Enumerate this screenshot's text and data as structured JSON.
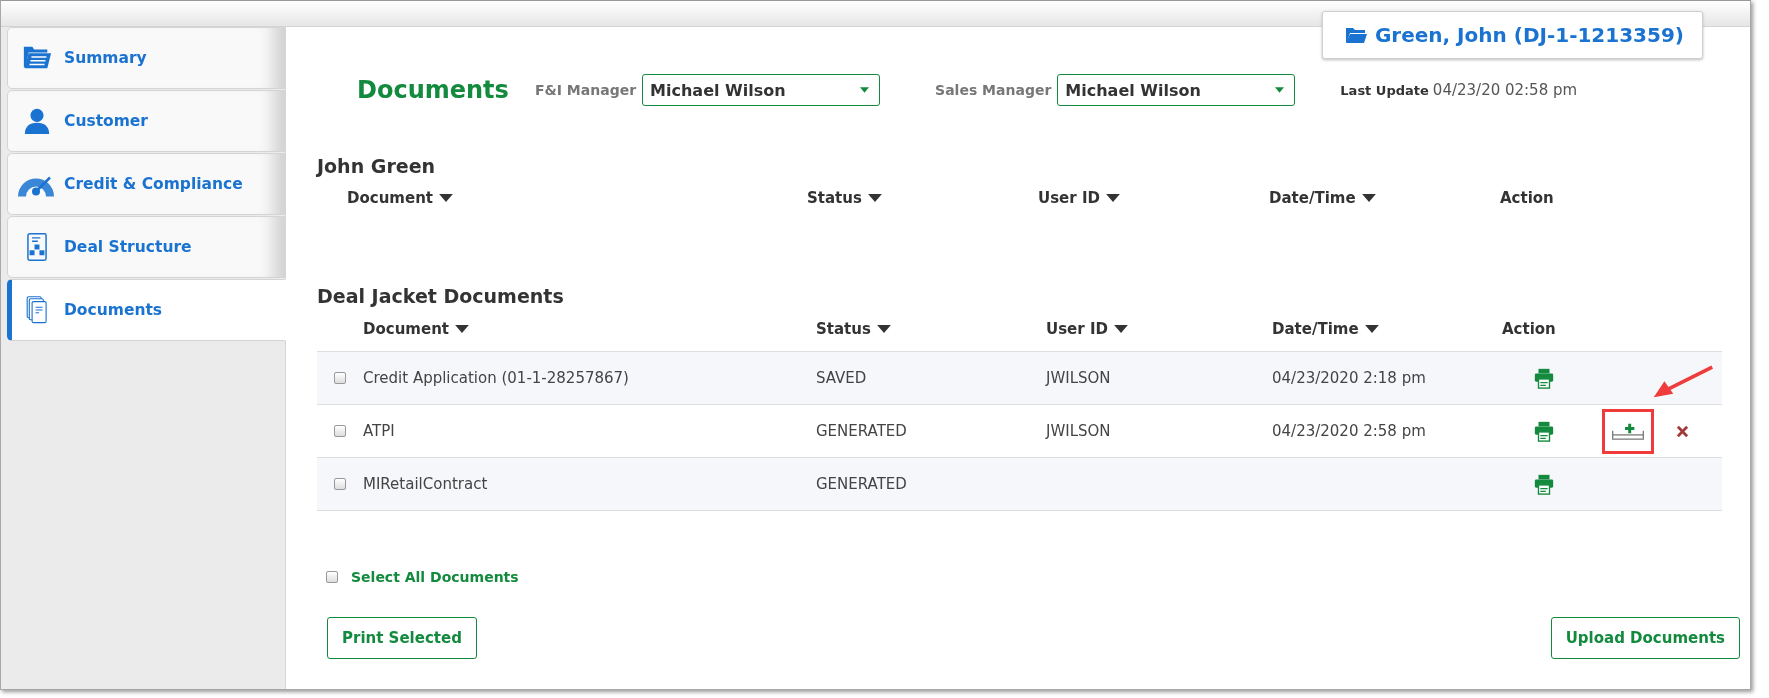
{
  "sidebar": {
    "items": [
      {
        "label": "Summary",
        "selected": false
      },
      {
        "label": "Customer",
        "selected": false
      },
      {
        "label": "Credit & Compliance",
        "selected": false
      },
      {
        "label": "Deal Structure",
        "selected": false
      },
      {
        "label": "Documents",
        "selected": true
      }
    ]
  },
  "deal_chip": {
    "title": "Green, John (DJ-1-1213359)"
  },
  "header": {
    "title": "Documents",
    "fi_manager": {
      "label": "F&I Manager",
      "value": "Michael Wilson"
    },
    "sales_manager": {
      "label": "Sales Manager",
      "value": "Michael Wilson"
    },
    "last_update": {
      "label": "Last Update",
      "value": "04/23/20 02:58 pm"
    }
  },
  "customer_section": {
    "title": "John Green",
    "columns": [
      "Document",
      "Status",
      "User ID",
      "Date/Time",
      "Action"
    ]
  },
  "deal_jacket_section": {
    "title": "Deal Jacket Documents",
    "columns": [
      "Document",
      "Status",
      "User ID",
      "Date/Time",
      "Action"
    ],
    "rows": [
      {
        "document": "Credit Application (01-1-28257867)",
        "status": "SAVED",
        "user_id": "JWILSON",
        "date_time": "04/23/2020 2:18 pm",
        "checked": false,
        "actions": [
          {
            "kind": "print",
            "highlighted": false
          }
        ]
      },
      {
        "document": "ATPI",
        "status": "GENERATED",
        "user_id": "JWILSON",
        "date_time": "04/23/2020 2:58 pm",
        "checked": false,
        "actions": [
          {
            "kind": "print",
            "highlighted": false
          },
          {
            "kind": "add",
            "highlighted": true
          },
          {
            "kind": "delete",
            "highlighted": false
          }
        ]
      },
      {
        "document": "MIRetailContract",
        "status": "GENERATED",
        "checked": false,
        "actions": [
          {
            "kind": "print",
            "highlighted": false
          }
        ]
      }
    ]
  },
  "select_all": {
    "label": "Select All Documents",
    "checked": false
  },
  "buttons": [
    {
      "label": "Print Selected"
    },
    {
      "label": "Upload Documents"
    }
  ]
}
